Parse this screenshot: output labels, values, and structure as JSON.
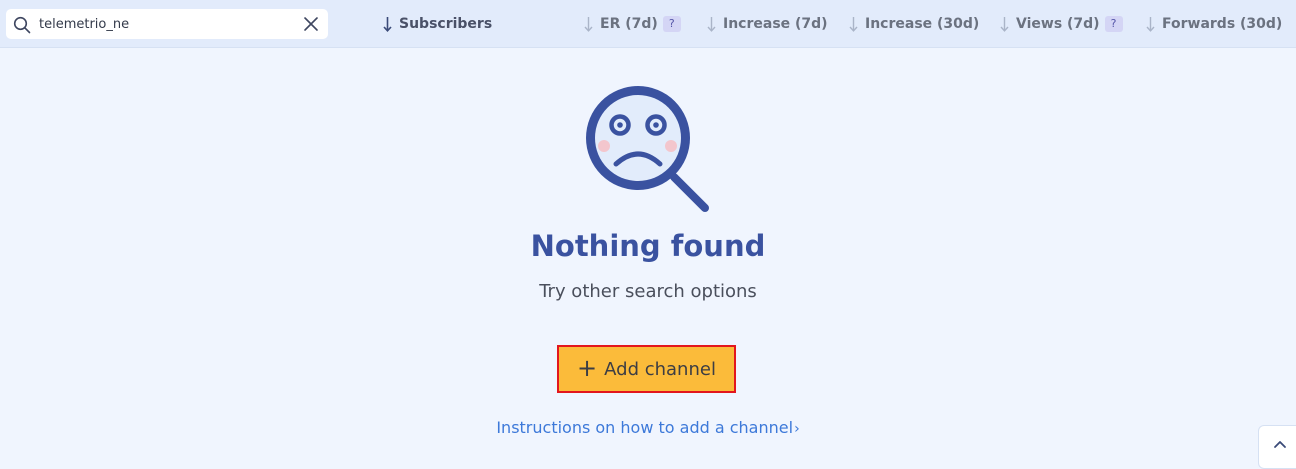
{
  "search": {
    "value": "telemetrio_ne",
    "placeholder": ""
  },
  "columns": [
    {
      "label": "Subscribers",
      "active": true,
      "help": ""
    },
    {
      "label": "ER (7d)",
      "active": false,
      "help": "?"
    },
    {
      "label": "Increase (7d)",
      "active": false,
      "help": ""
    },
    {
      "label": "Increase (30d)",
      "active": false,
      "help": ""
    },
    {
      "label": "Views (7d)",
      "active": false,
      "help": "?"
    },
    {
      "label": "Forwards (30d)",
      "active": false,
      "help": ""
    }
  ],
  "empty_state": {
    "icon": "sad-magnifier-icon",
    "title": "Nothing found",
    "subtitle": "Try other search options"
  },
  "add_button": {
    "label": "Add channel",
    "icon": "plus-icon"
  },
  "instructions": {
    "label": "Instructions on how to add a channel"
  },
  "colors": {
    "accent": "#3a52a0",
    "button_fill": "#fbbb3a",
    "button_border": "#e3161d",
    "link": "#3d79d9",
    "topbar": "#e2ebfb",
    "background": "#f0f5fe"
  }
}
